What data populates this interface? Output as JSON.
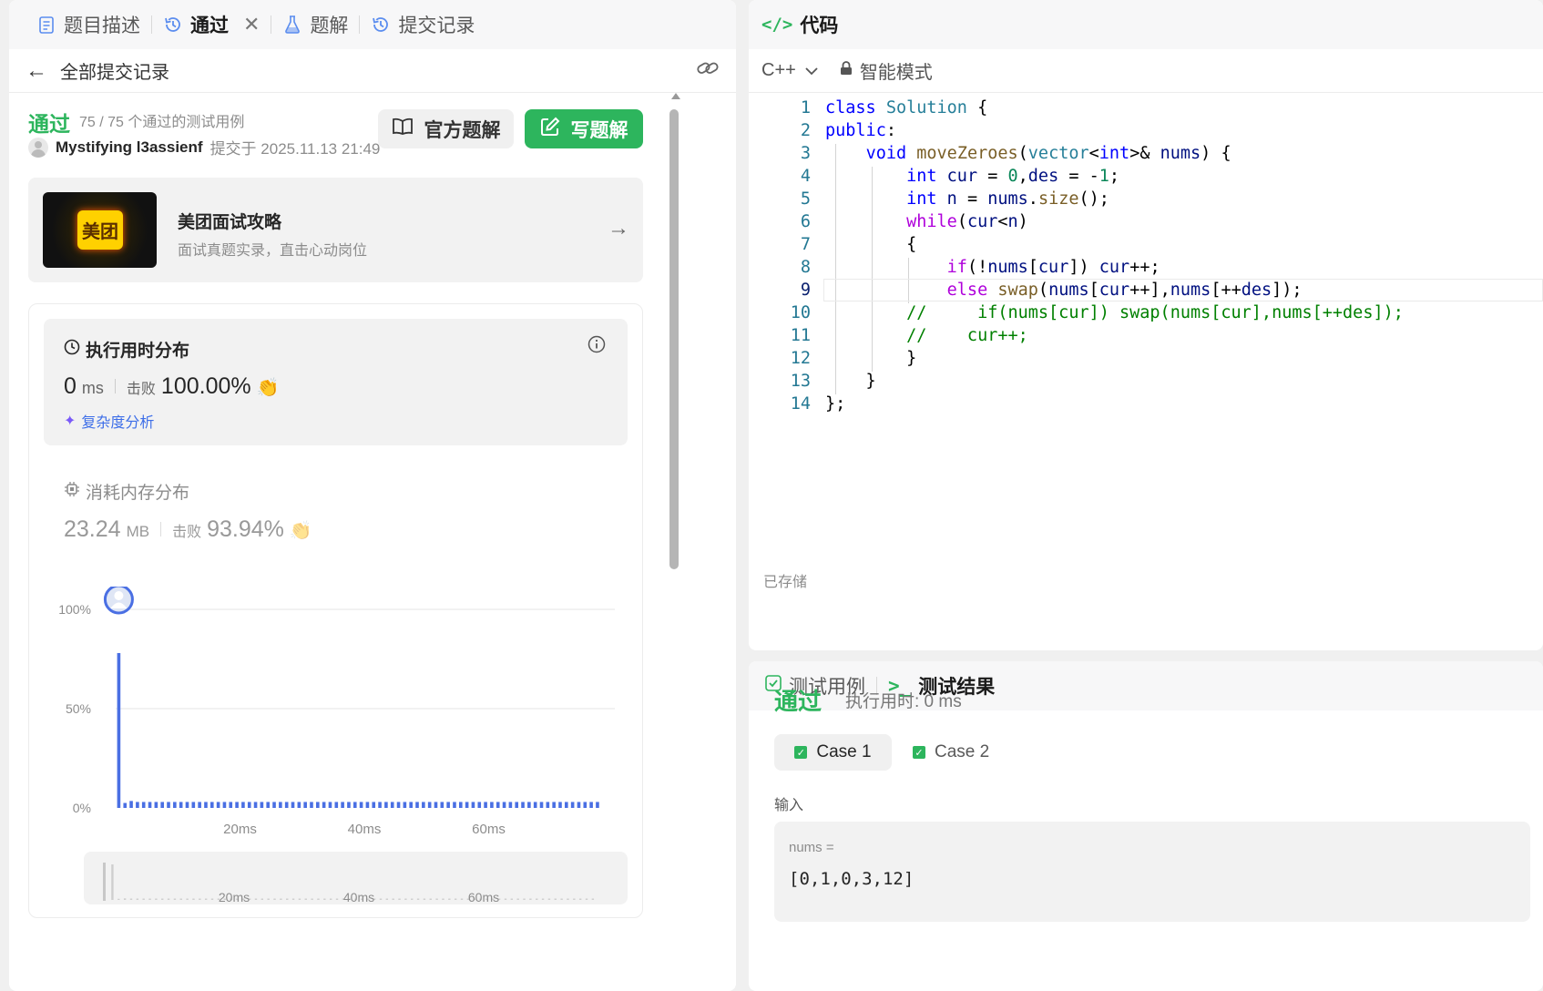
{
  "left": {
    "tabs": [
      {
        "label": "题目描述",
        "icon": "document-icon"
      },
      {
        "label": "通过",
        "icon": "history-icon"
      },
      {
        "label": "题解",
        "icon": "flask-icon"
      },
      {
        "label": "提交记录",
        "icon": "history-icon"
      }
    ],
    "back_label": "全部提交记录",
    "status": "通过",
    "testcases": "75 / 75 个通过的测试用例",
    "user": "Mystifying l3assienf",
    "submitted_at": "提交于 2025.11.13 21:49",
    "official_solution": "官方题解",
    "write_solution": "写题解",
    "ad": {
      "logo_text": "美团",
      "title": "美团面试攻略",
      "subtitle": "面试真题实录，直击心动岗位"
    },
    "runtime": {
      "title": "执行用时分布",
      "value": "0",
      "unit": "ms",
      "beats_label": "击败",
      "beats": "100.00%",
      "complexity": "复杂度分析"
    },
    "memory": {
      "title": "消耗内存分布",
      "value": "23.24",
      "unit": "MB",
      "beats_label": "击败",
      "beats": "93.94%"
    }
  },
  "chart_data": {
    "type": "bar",
    "title": "",
    "xlabel": "",
    "ylabel": "",
    "yticks": [
      "0%",
      "50%",
      "100%"
    ],
    "xticks": [
      "20ms",
      "40ms",
      "60ms"
    ],
    "xlim": [
      0,
      80
    ],
    "ylim": [
      0,
      100
    ],
    "x": [
      0,
      1,
      2,
      3,
      4,
      5,
      6,
      7,
      8,
      9,
      10,
      11,
      12,
      13,
      14,
      15,
      16,
      17,
      18,
      19,
      20,
      21,
      22,
      23,
      24,
      25,
      26,
      27,
      28,
      29,
      30,
      31,
      32,
      33,
      34,
      35,
      36,
      37,
      38,
      39,
      40,
      41,
      42,
      43,
      44,
      45,
      46,
      47,
      48,
      49,
      50,
      51,
      52,
      53,
      54,
      55,
      56,
      57,
      58,
      59,
      60,
      61,
      62,
      63,
      64,
      65,
      66,
      67,
      68,
      69,
      70,
      71,
      72,
      73,
      74,
      75,
      76,
      77
    ],
    "values": [
      78,
      2.5,
      3.5,
      3,
      3,
      3,
      3,
      3,
      3,
      3,
      3,
      3,
      3,
      3,
      3,
      3,
      3,
      3,
      3,
      3,
      3,
      3,
      3,
      3,
      3,
      3,
      3,
      3,
      3,
      3,
      3,
      3,
      3,
      3,
      3,
      3,
      3,
      3,
      3,
      3,
      3,
      3,
      3,
      3,
      3,
      3,
      3,
      3,
      3,
      3,
      3,
      3,
      3,
      3,
      3,
      3,
      3,
      3,
      3,
      3,
      3,
      3,
      3,
      3,
      3,
      3,
      3,
      3,
      3,
      3,
      3,
      3,
      3,
      3,
      3,
      3,
      3,
      3
    ],
    "highlight_x": 0,
    "bar_color": "#4a6fe3",
    "brush": {
      "xticks": [
        "20ms",
        "40ms",
        "60ms"
      ]
    }
  },
  "code": {
    "tab_label": "代码",
    "language": "C++",
    "mode": "智能模式",
    "saved": "已存储",
    "current_line": 9,
    "lines": [
      [
        [
          "kw",
          "class "
        ],
        [
          "ty",
          "Solution"
        ],
        [
          "pl",
          " {"
        ]
      ],
      [
        [
          "kw",
          "public"
        ],
        [
          "pl",
          ":"
        ]
      ],
      [
        [
          "pl",
          "    "
        ],
        [
          "kw",
          "void "
        ],
        [
          "fn",
          "moveZeroes"
        ],
        [
          "pl",
          "("
        ],
        [
          "ty",
          "vector"
        ],
        [
          "pl",
          "<"
        ],
        [
          "kw",
          "int"
        ],
        [
          "pl",
          ">& "
        ],
        [
          "var",
          "nums"
        ],
        [
          "pl",
          ") {"
        ]
      ],
      [
        [
          "pl",
          "        "
        ],
        [
          "kw",
          "int "
        ],
        [
          "var",
          "cur"
        ],
        [
          "pl",
          " = "
        ],
        [
          "num",
          "0"
        ],
        [
          "pl",
          ","
        ],
        [
          "var",
          "des"
        ],
        [
          "pl",
          " = -"
        ],
        [
          "num",
          "1"
        ],
        [
          "pl",
          ";"
        ]
      ],
      [
        [
          "pl",
          "        "
        ],
        [
          "kw",
          "int "
        ],
        [
          "var",
          "n"
        ],
        [
          "pl",
          " = "
        ],
        [
          "var",
          "nums"
        ],
        [
          "pl",
          "."
        ],
        [
          "fn",
          "size"
        ],
        [
          "pl",
          "();"
        ]
      ],
      [
        [
          "pl",
          "        "
        ],
        [
          "kw2",
          "while"
        ],
        [
          "pl",
          "("
        ],
        [
          "var",
          "cur"
        ],
        [
          "pl",
          "<"
        ],
        [
          "var",
          "n"
        ],
        [
          "pl",
          ")"
        ]
      ],
      [
        [
          "pl",
          "        {"
        ]
      ],
      [
        [
          "pl",
          "            "
        ],
        [
          "kw2",
          "if"
        ],
        [
          "pl",
          "(!"
        ],
        [
          "var",
          "nums"
        ],
        [
          "pl",
          "["
        ],
        [
          "var",
          "cur"
        ],
        [
          "pl",
          "]) "
        ],
        [
          "var",
          "cur"
        ],
        [
          "pl",
          "++;"
        ]
      ],
      [
        [
          "pl",
          "            "
        ],
        [
          "kw2",
          "else "
        ],
        [
          "fn",
          "swap"
        ],
        [
          "pl",
          "("
        ],
        [
          "var",
          "nums"
        ],
        [
          "pl",
          "["
        ],
        [
          "var",
          "cur"
        ],
        [
          "pl",
          "++],"
        ],
        [
          "var",
          "nums"
        ],
        [
          "pl",
          "[++"
        ],
        [
          "var",
          "des"
        ],
        [
          "pl",
          "]);"
        ]
      ],
      [
        [
          "pl",
          "        "
        ],
        [
          "cm",
          "//     if(nums[cur]) swap(nums[cur],nums[++des]);"
        ]
      ],
      [
        [
          "pl",
          "        "
        ],
        [
          "cm",
          "//    cur++;"
        ]
      ],
      [
        [
          "pl",
          "        }"
        ]
      ],
      [
        [
          "pl",
          "    }"
        ]
      ],
      [
        [
          "pl",
          "};"
        ]
      ]
    ]
  },
  "result": {
    "tab_testcase": "测试用例",
    "tab_result": "测试结果",
    "status": "通过",
    "runtime": "执行用时: 0 ms",
    "cases": [
      "Case 1",
      "Case 2"
    ],
    "input_label": "输入",
    "var_name": "nums =",
    "var_value": "[0,1,0,3,12]"
  }
}
